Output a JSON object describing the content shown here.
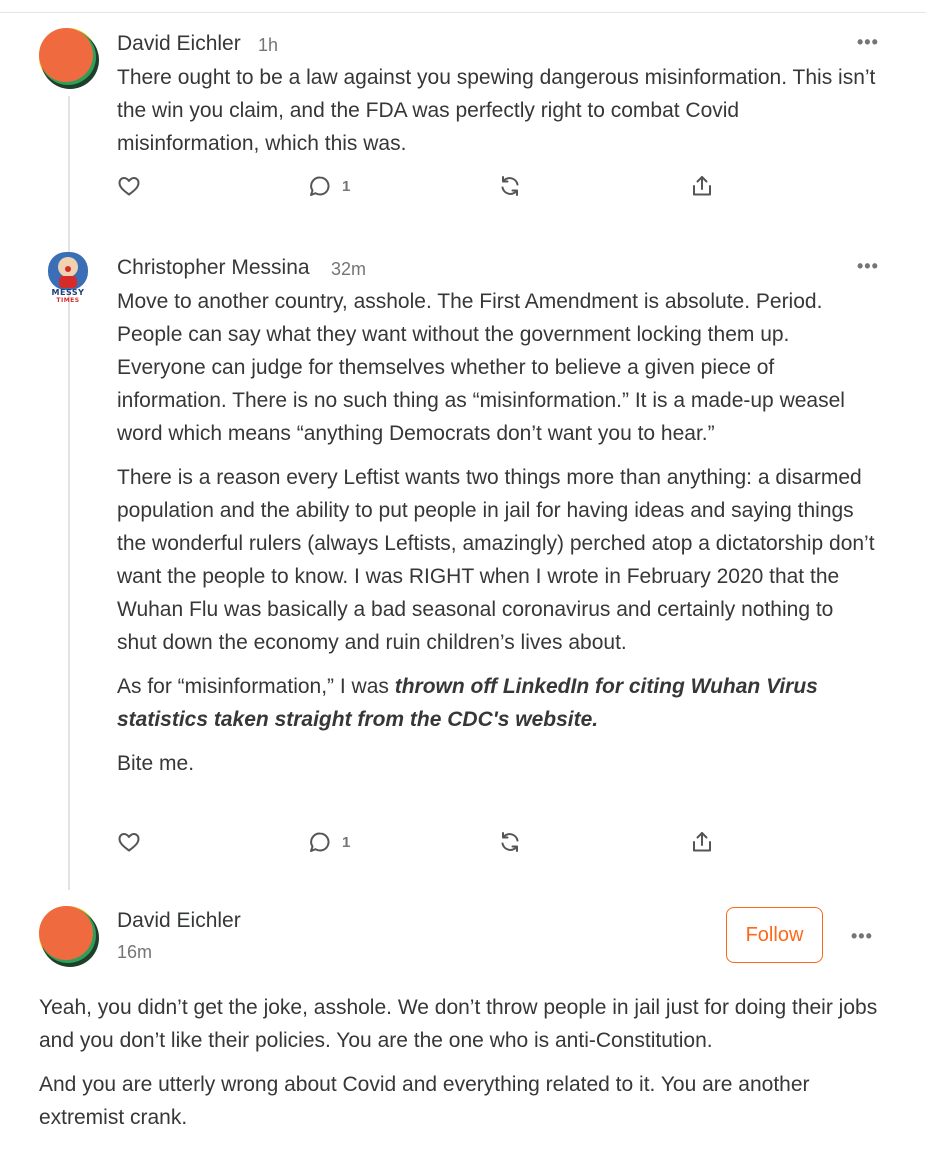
{
  "comments": [
    {
      "author": "David Eichler",
      "time": "1h",
      "more": "•••",
      "paragraphs": [
        "There ought to be a law against you spewing dangerous misinformation. This isn’t the win you claim, and the FDA was perfectly right to combat Covid misinformation, which this was."
      ],
      "reply_count": "1"
    },
    {
      "author": "Christopher Messina",
      "time": "32m",
      "more": "•••",
      "avatar_text": [
        "MESSY",
        "TIMES"
      ],
      "paragraphs": [
        "Move to another country, asshole.  The First Amendment is absolute.  Period.  People can say what they want without the government locking them up.  Everyone can judge for themselves whether to believe a given piece of information.  There is no such thing as “misinformation.”  It is a made-up weasel word which means “anything Democrats don’t want you to hear.”",
        "There is a reason every Leftist wants two things more than anything: a disarmed population and the ability to put people in jail for having ideas and saying things the wonderful rulers (always Leftists, amazingly) perched atop a dictatorship don’t want the people to know.  I was RIGHT when I wrote in February 2020 that the Wuhan Flu was basically a bad seasonal coronavirus and certainly nothing to shut down the economy and ruin children’s lives about."
      ],
      "p3_lead": "As for “misinformation,” I was ",
      "p3_emph": "thrown off LinkedIn for citing Wuhan Virus statistics taken straight from the CDC's website.",
      "p4": "Bite me.",
      "reply_count": "1"
    },
    {
      "author": "David Eichler",
      "time": "16m",
      "follow_label": "Follow",
      "more": "•••",
      "paragraphs": [
        "Yeah, you didn’t get the joke, asshole. We don’t throw people in jail just for doing their jobs and you don’t like their policies. You are the one who is anti-Constitution.",
        "And you are utterly wrong about Covid and everything related to it. You are another extremist crank."
      ]
    }
  ],
  "colors": {
    "accent": "#ff6719",
    "text": "#363737",
    "muted": "#757575"
  },
  "icons": [
    "heart-icon",
    "comment-icon",
    "restack-icon",
    "share-icon",
    "more-icon"
  ]
}
